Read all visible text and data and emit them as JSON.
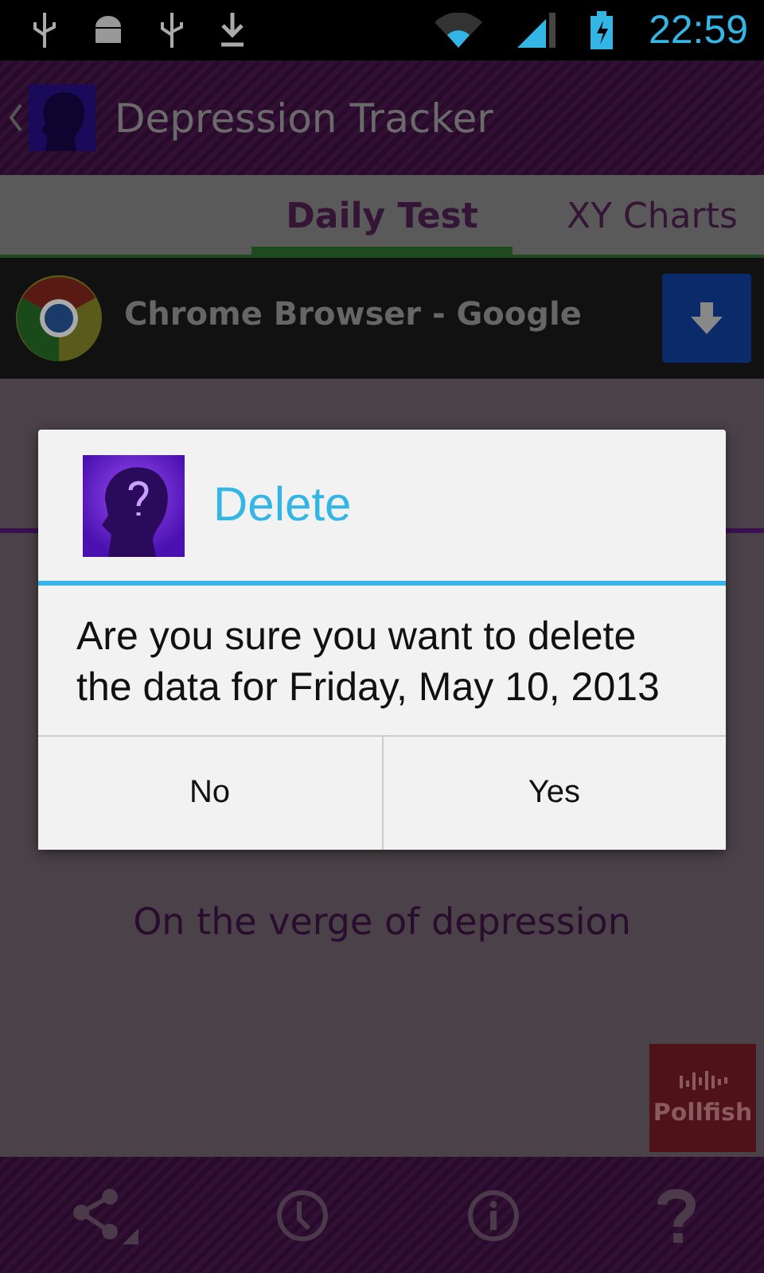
{
  "status_bar": {
    "time": "22:59"
  },
  "action_bar": {
    "title": "Depression Tracker"
  },
  "tabs": [
    {
      "label": "Daily Test",
      "selected": true
    },
    {
      "label": "XY Charts",
      "selected": false
    }
  ],
  "ad": {
    "title": "Chrome Browser - Google"
  },
  "result": {
    "label": "On the verge of depression"
  },
  "dialog": {
    "title": "Delete",
    "message": "Are you sure you want to delete the data for Friday, May 10, 2013",
    "buttons": [
      {
        "label": "No"
      },
      {
        "label": "Yes"
      }
    ]
  },
  "survey_badge": {
    "label": "Pollfish"
  },
  "bottom_bar": {
    "items": [
      {
        "kind": "share"
      },
      {
        "kind": "clock"
      },
      {
        "kind": "info"
      },
      {
        "kind": "help"
      }
    ]
  }
}
